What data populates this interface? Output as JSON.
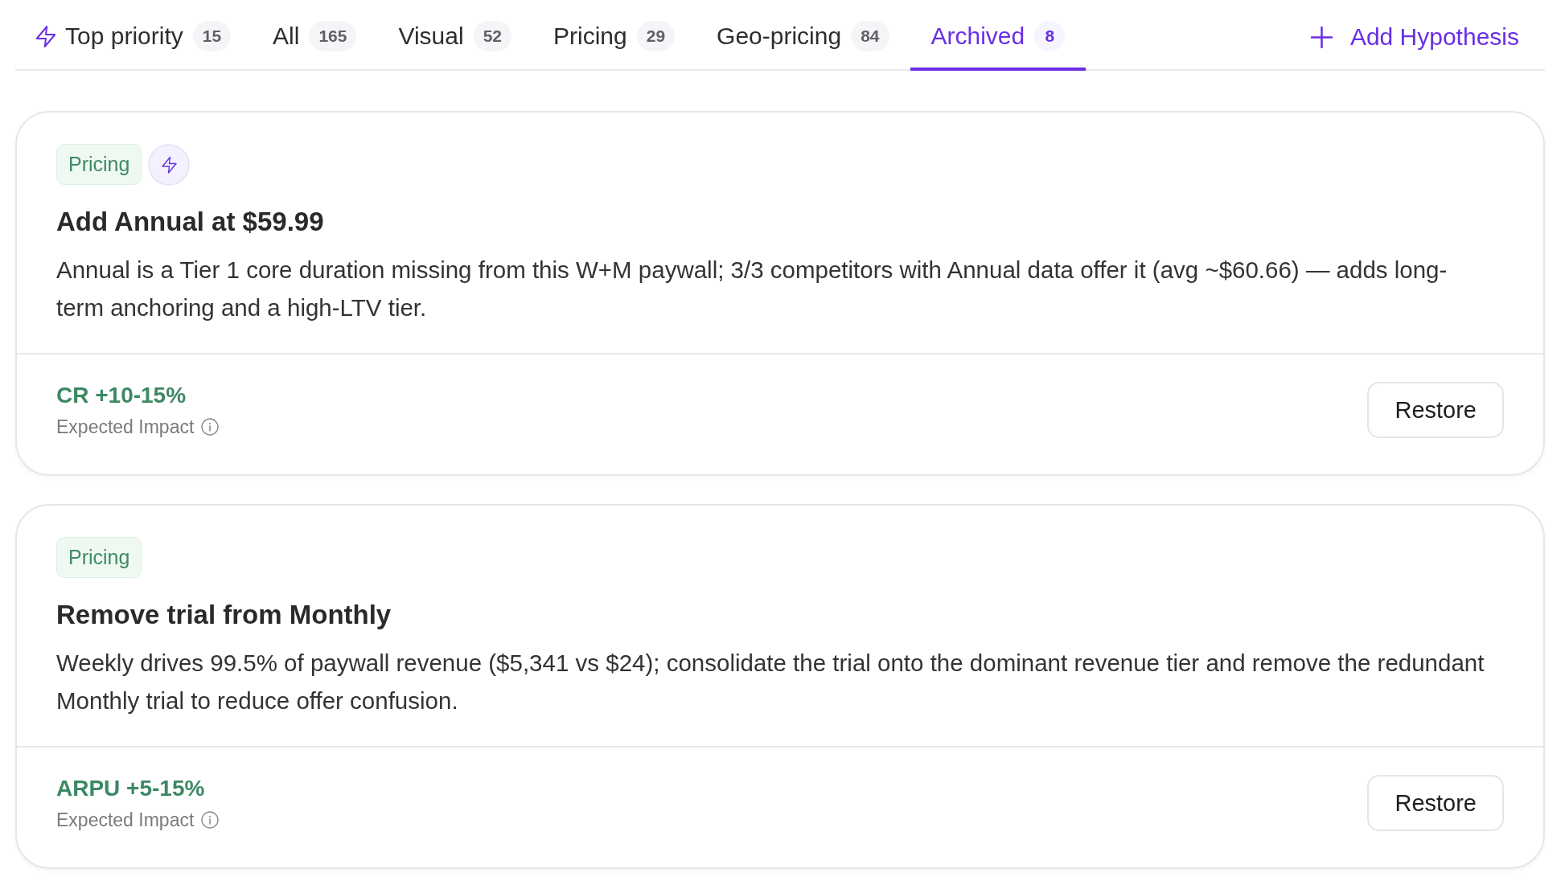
{
  "tabs": [
    {
      "kind": "priority",
      "label": "Top priority",
      "count": "15",
      "selected": false
    },
    {
      "kind": "filter",
      "label": "All",
      "count": "165",
      "selected": false
    },
    {
      "kind": "filter",
      "label": "Visual",
      "count": "52",
      "selected": false
    },
    {
      "kind": "filter",
      "label": "Pricing",
      "count": "29",
      "selected": false
    },
    {
      "kind": "filter",
      "label": "Geo-pricing",
      "count": "84",
      "selected": false
    },
    {
      "kind": "filter",
      "label": "Archived",
      "count": "8",
      "selected": true
    }
  ],
  "add_button": {
    "label": "Add Hypothesis"
  },
  "cards": [
    {
      "tag": "Pricing",
      "top_priority": true,
      "title": "Add Annual at $59.99",
      "description": "Annual is a Tier 1 core duration missing from this W+M paywall; 3/3 competitors with Annual data offer it (avg ~$60.66) — adds long-term anchoring and a high-LTV tier.",
      "impact": {
        "value": "CR +10-15%",
        "label": "Expected Impact"
      },
      "button": "Restore"
    },
    {
      "tag": "Pricing",
      "top_priority": false,
      "title": "Remove trial from Monthly",
      "description": "Weekly drives 99.5% of paywall revenue ($5,341 vs $24); consolidate the trial onto the dominant revenue tier and remove the redundant Monthly trial to reduce offer confusion.",
      "impact": {
        "value": "ARPU +5-15%",
        "label": "Expected Impact"
      },
      "button": "Restore"
    }
  ]
}
